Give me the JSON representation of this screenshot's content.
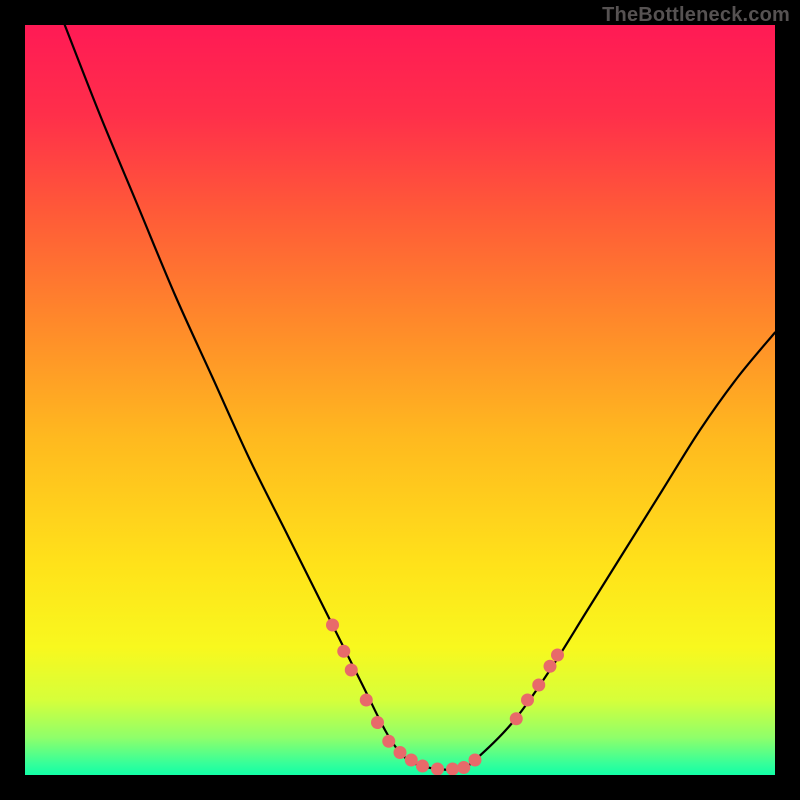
{
  "attribution": "TheBottleneck.com",
  "gradient": {
    "stops": [
      {
        "offset": 0.0,
        "color": "#ff1a55"
      },
      {
        "offset": 0.12,
        "color": "#ff2f4a"
      },
      {
        "offset": 0.25,
        "color": "#ff5a38"
      },
      {
        "offset": 0.4,
        "color": "#ff8a2a"
      },
      {
        "offset": 0.55,
        "color": "#ffb91f"
      },
      {
        "offset": 0.72,
        "color": "#ffe21a"
      },
      {
        "offset": 0.83,
        "color": "#f8f81e"
      },
      {
        "offset": 0.9,
        "color": "#d6ff3a"
      },
      {
        "offset": 0.95,
        "color": "#8fff6a"
      },
      {
        "offset": 0.985,
        "color": "#35ff9a"
      },
      {
        "offset": 1.0,
        "color": "#12ffa6"
      }
    ]
  },
  "chart_data": {
    "type": "line",
    "title": "",
    "xlabel": "",
    "ylabel": "",
    "xlim": [
      0,
      100
    ],
    "ylim": [
      0,
      100
    ],
    "series": [
      {
        "name": "bottleneck-curve",
        "x": [
          5.3,
          10,
          15,
          20,
          25,
          30,
          35,
          40,
          45,
          48,
          50,
          52,
          55,
          58,
          60,
          65,
          70,
          75,
          80,
          85,
          90,
          95,
          100
        ],
        "y": [
          100,
          88,
          76,
          64,
          53,
          42,
          32,
          22,
          12,
          6,
          3,
          1.5,
          0.8,
          0.8,
          2,
          7,
          14,
          22,
          30,
          38,
          46,
          53,
          59
        ]
      }
    ],
    "markers": {
      "name": "highlight-points",
      "color": "#e86a6a",
      "radius_px": 6.5,
      "points": [
        {
          "x": 41.0,
          "y": 20.0
        },
        {
          "x": 42.5,
          "y": 16.5
        },
        {
          "x": 43.5,
          "y": 14.0
        },
        {
          "x": 45.5,
          "y": 10.0
        },
        {
          "x": 47.0,
          "y": 7.0
        },
        {
          "x": 48.5,
          "y": 4.5
        },
        {
          "x": 50.0,
          "y": 3.0
        },
        {
          "x": 51.5,
          "y": 2.0
        },
        {
          "x": 53.0,
          "y": 1.2
        },
        {
          "x": 55.0,
          "y": 0.8
        },
        {
          "x": 57.0,
          "y": 0.8
        },
        {
          "x": 58.5,
          "y": 1.0
        },
        {
          "x": 60.0,
          "y": 2.0
        },
        {
          "x": 65.5,
          "y": 7.5
        },
        {
          "x": 67.0,
          "y": 10.0
        },
        {
          "x": 68.5,
          "y": 12.0
        },
        {
          "x": 70.0,
          "y": 14.5
        },
        {
          "x": 71.0,
          "y": 16.0
        }
      ]
    }
  }
}
